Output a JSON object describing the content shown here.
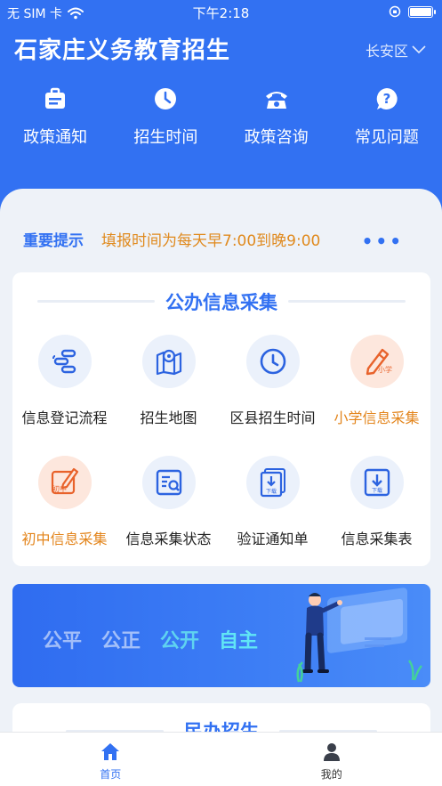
{
  "status_bar": {
    "carrier": "无 SIM 卡",
    "time": "下午2:18"
  },
  "header": {
    "title": "石家庄义务教育招生",
    "district": "长安区"
  },
  "top_nav": [
    {
      "label": "政策通知",
      "icon": "briefcase-icon"
    },
    {
      "label": "招生时间",
      "icon": "clock-icon"
    },
    {
      "label": "政策咨询",
      "icon": "phone-icon"
    },
    {
      "label": "常见问题",
      "icon": "question-icon"
    }
  ],
  "notice": {
    "tag": "重要提示",
    "text": "填报时间为每天早7:00到晚9:00",
    "more": "•••"
  },
  "public_section": {
    "title": "公办信息采集",
    "items": [
      {
        "label": "信息登记流程",
        "icon": "flow-icon"
      },
      {
        "label": "招生地图",
        "icon": "map-icon"
      },
      {
        "label": "区县招生时间",
        "icon": "clock-icon"
      },
      {
        "label": "小学信息采集",
        "icon": "pencil-icon",
        "badge": "小学"
      },
      {
        "label": "初中信息采集",
        "icon": "pencil-icon",
        "badge": "初中"
      },
      {
        "label": "信息采集状态",
        "icon": "search-doc-icon"
      },
      {
        "label": "验证通知单",
        "icon": "download-doc-icon",
        "badge": "下载"
      },
      {
        "label": "信息采集表",
        "icon": "download-doc-icon",
        "badge": "下载"
      }
    ]
  },
  "banner": {
    "slogans": [
      "公平",
      "公正",
      "公开",
      "自主"
    ]
  },
  "private_section": {
    "title": "民办招生"
  },
  "tabbar": [
    {
      "label": "首页",
      "icon": "home-icon"
    },
    {
      "label": "我的",
      "icon": "user-icon"
    }
  ],
  "colors": {
    "primary": "#3271f2",
    "accent_orange": "#e3851c",
    "background": "#eef2f8"
  }
}
